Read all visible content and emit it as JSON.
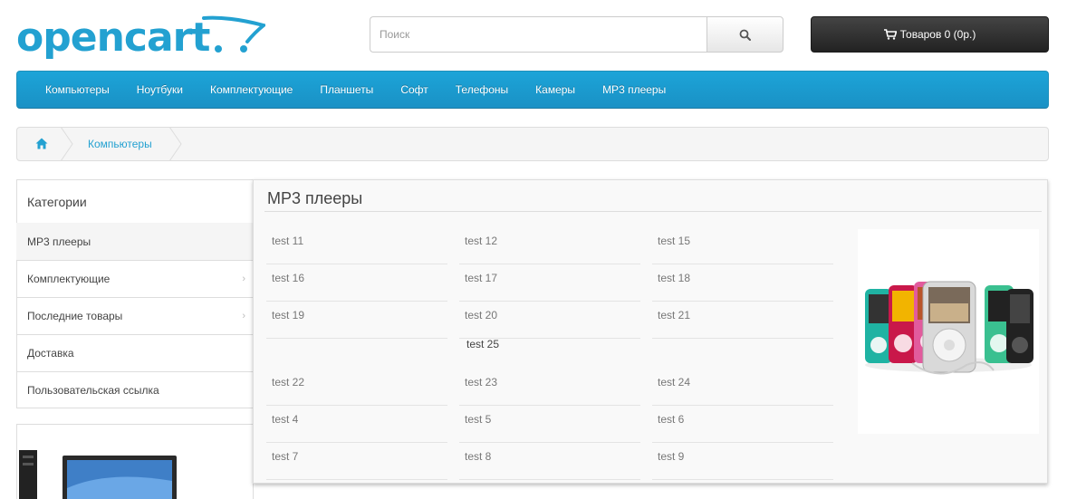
{
  "header": {
    "logo_text": "opencart",
    "search_placeholder": "Поиск",
    "cart_label": "Товаров 0 (0р.)"
  },
  "menu": {
    "items": [
      "Компьютеры",
      "Ноутбуки",
      "Комплектующие",
      "Планшеты",
      "Софт",
      "Телефоны",
      "Камеры",
      "MP3 плееры"
    ]
  },
  "breadcrumb": {
    "link": "Компьютеры"
  },
  "sidebar": {
    "heading": "Категории",
    "items": [
      {
        "label": "MP3 плееры"
      },
      {
        "label": "Комплектующие"
      },
      {
        "label": "Последние товары"
      },
      {
        "label": "Доставка"
      },
      {
        "label": "Пользовательская ссылка"
      }
    ]
  },
  "dropdown": {
    "title": "MP3 плееры",
    "links": [
      "test 11",
      "test 12",
      "test 15",
      "test 16",
      "test 17",
      "test 18",
      "test 19",
      "test 20",
      "test 21",
      "test 25",
      "test 22",
      "test 23",
      "test 24",
      "test 4",
      "test 5",
      "test 6",
      "test 7",
      "test 8",
      "test 9"
    ]
  },
  "colors": {
    "brand": "#23a1d1",
    "menu_bg": "#1ca4d8",
    "cart_bg": "#333333"
  }
}
